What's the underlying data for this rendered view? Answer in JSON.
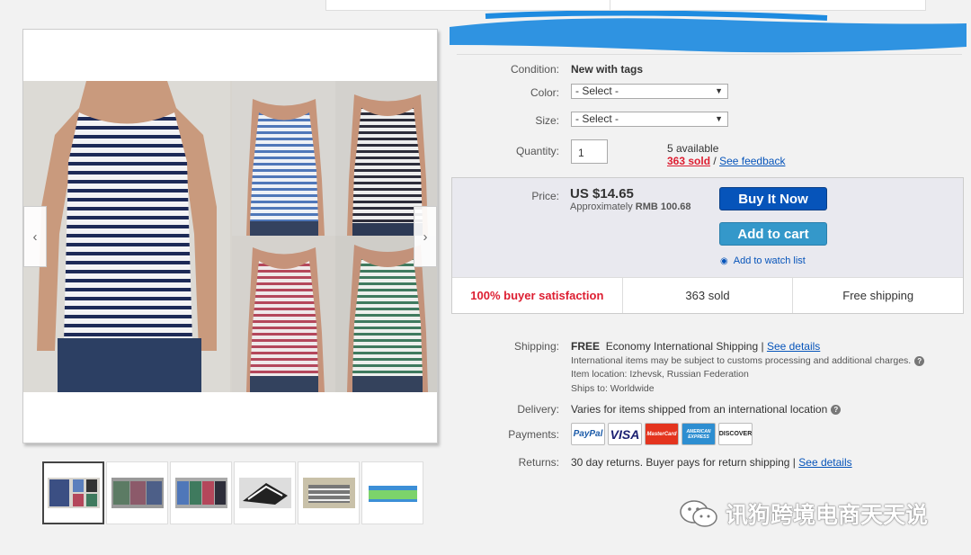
{
  "listing": {
    "condition_label": "Condition:",
    "condition_value": "New with tags",
    "color_label": "Color:",
    "color_select": "- Select -",
    "size_label": "Size:",
    "size_select": "- Select -",
    "quantity_label": "Quantity:",
    "quantity_value": "1",
    "available": "5 available",
    "sold_link": "363 sold",
    "separator": "/",
    "feedback_link": "See feedback"
  },
  "buy_box": {
    "price_label": "Price:",
    "price": "US $14.65",
    "approx_prefix": "Approximately",
    "approx_value": "RMB 100.68",
    "buy_now": "Buy It Now",
    "add_to_cart": "Add to cart",
    "watch_list": "Add to watch list",
    "satisfaction": "100% buyer satisfaction",
    "sold_count": "363 sold",
    "shipping_badge": "Free shipping"
  },
  "shipping": {
    "label": "Shipping:",
    "free": "FREE",
    "method": "Economy International Shipping |",
    "details_link": "See details",
    "customs_note": "International items may be subject to customs processing and additional charges.",
    "location_label": "Item location:",
    "location_value": "Izhevsk, Russian Federation",
    "ships_to_label": "Ships to:",
    "ships_to_value": "Worldwide"
  },
  "delivery": {
    "label": "Delivery:",
    "value": "Varies for items shipped from an international location"
  },
  "payments": {
    "label": "Payments:",
    "methods": [
      "PayPal",
      "VISA",
      "MasterCard",
      "AMERICAN EXPRESS",
      "DISCOVER"
    ]
  },
  "returns": {
    "label": "Returns:",
    "value": "30 day returns. Buyer pays for return shipping |",
    "details_link": "See details"
  },
  "watermark": {
    "text": "讯狗跨境电商天天说"
  },
  "icons": {
    "prev": "chevron-left-icon",
    "next": "chevron-right-icon",
    "watch": "eye-icon",
    "help": "question-circle-icon",
    "wechat": "wechat-icon"
  },
  "colors": {
    "link": "#0654ba",
    "buy_now": "#0654ba",
    "add_to_cart": "#3498ca",
    "sold_red": "#dd1e31",
    "scribble": "#1e8be0"
  }
}
